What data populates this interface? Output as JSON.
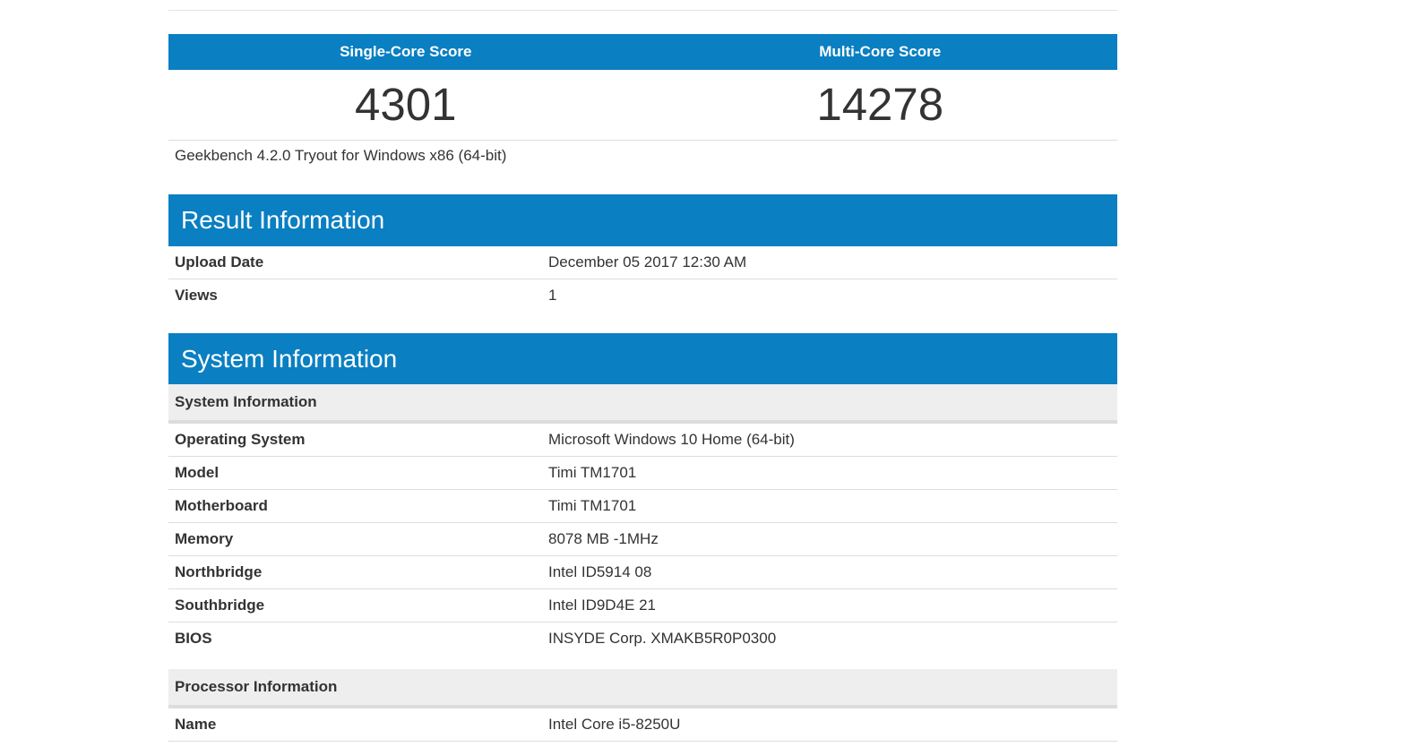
{
  "scores": {
    "single_label": "Single-Core Score",
    "multi_label": "Multi-Core Score",
    "single_value": "4301",
    "multi_value": "14278"
  },
  "version": "Geekbench 4.2.0 Tryout for Windows x86 (64-bit)",
  "result_info": {
    "title": "Result Information",
    "rows": [
      {
        "key": "Upload Date",
        "value": "December 05 2017 12:30 AM"
      },
      {
        "key": "Views",
        "value": "1"
      }
    ]
  },
  "system_info": {
    "title": "System Information",
    "subheading": "System Information",
    "rows": [
      {
        "key": "Operating System",
        "value": "Microsoft Windows 10 Home (64-bit)"
      },
      {
        "key": "Model",
        "value": "Timi TM1701"
      },
      {
        "key": "Motherboard",
        "value": "Timi TM1701"
      },
      {
        "key": "Memory",
        "value": "8078 MB -1MHz"
      },
      {
        "key": "Northbridge",
        "value": "Intel ID5914 08"
      },
      {
        "key": "Southbridge",
        "value": "Intel ID9D4E 21"
      },
      {
        "key": "BIOS",
        "value": "INSYDE Corp. XMAKB5R0P0300"
      }
    ]
  },
  "processor_info": {
    "subheading": "Processor Information",
    "rows": [
      {
        "key": "Name",
        "value": "Intel Core i5-8250U"
      }
    ]
  },
  "colors": {
    "header_blue": "#0a7fc2",
    "subhead_gray": "#eeeeee",
    "text": "#333333"
  }
}
